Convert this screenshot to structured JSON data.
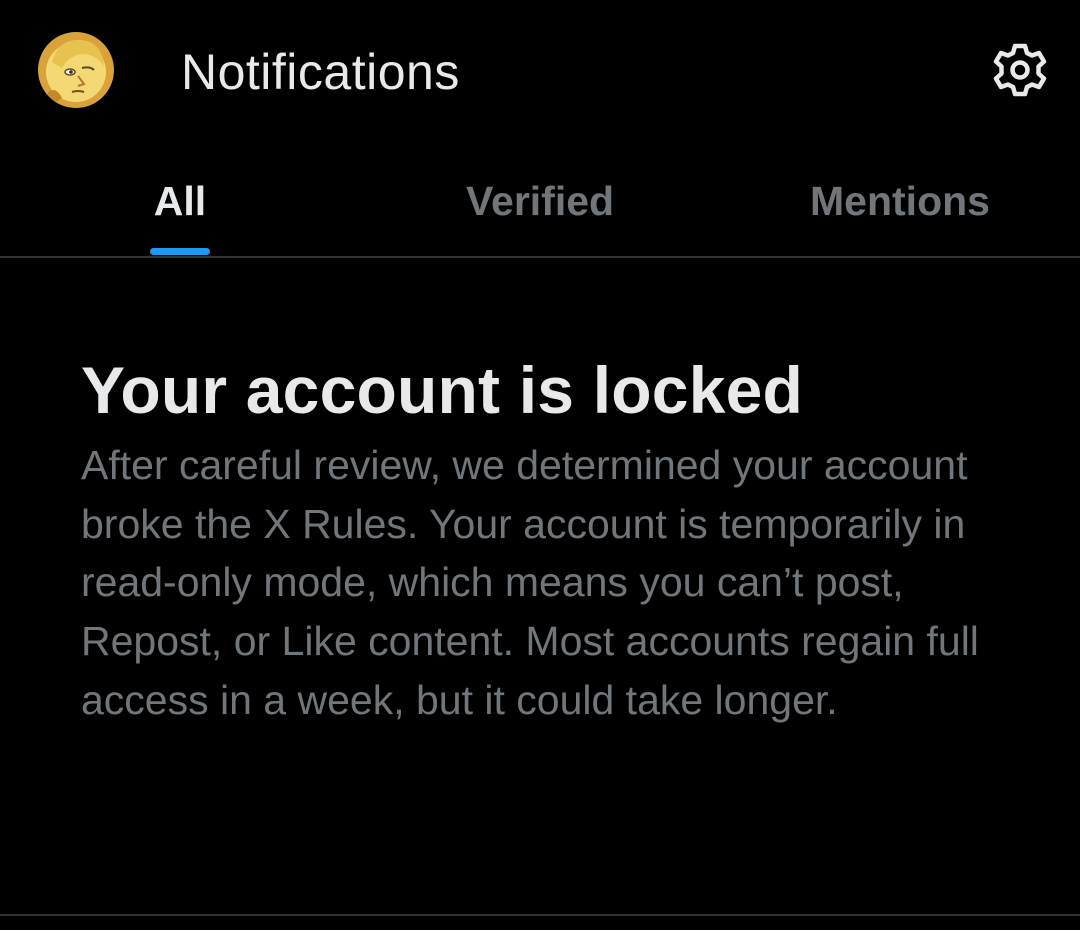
{
  "header": {
    "title": "Notifications",
    "avatar_icon": "user-avatar",
    "settings_icon": "gear-icon"
  },
  "tabs": [
    {
      "label": "All",
      "selected": true
    },
    {
      "label": "Verified",
      "selected": false
    },
    {
      "label": "Mentions",
      "selected": false
    }
  ],
  "notice": {
    "title": "Your account is locked",
    "body": "After careful review, we determined your account broke the X Rules. Your account is temporarily in read-only mode, which means you can’t post, Repost, or Like content. Most accounts regain full access in a week, but it could take longer."
  },
  "colors": {
    "background": "#000000",
    "primary_text": "#e7e9ea",
    "secondary_text": "#71767b",
    "accent": "#1d9bf0",
    "divider": "#2f3336"
  }
}
